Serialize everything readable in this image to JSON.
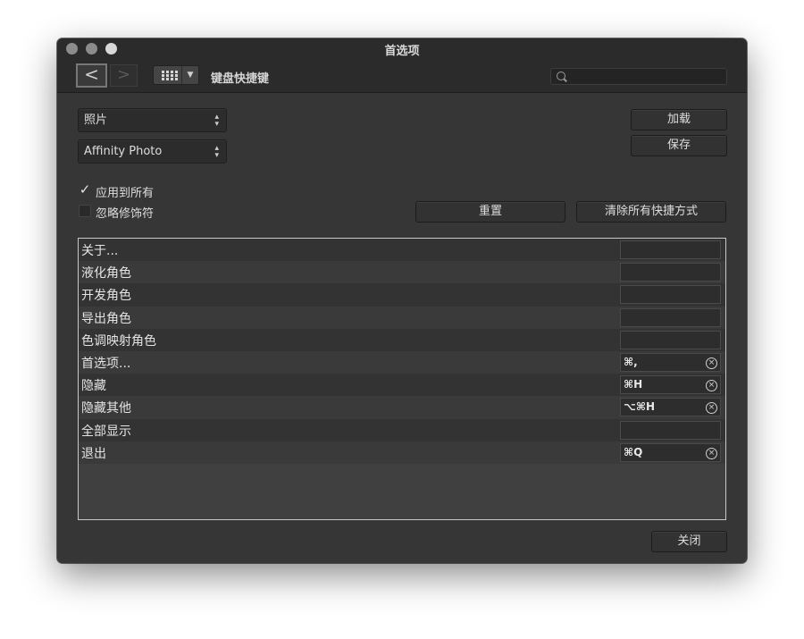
{
  "window": {
    "title": "首选项"
  },
  "toolbar": {
    "back_glyph": "<",
    "forward_glyph": ">",
    "view_caret": "▼",
    "section_label": "键盘快捷键",
    "search_placeholder": ""
  },
  "controls": {
    "category_select": "照片",
    "app_select": "Affinity Photo",
    "select_arrows": "⌃⌄",
    "load_button": "加载",
    "save_button": "保存",
    "apply_all": {
      "label": "应用到所有",
      "checked": true,
      "mark": "✓"
    },
    "ignore_modifiers": {
      "label": "忽略修饰符",
      "checked": false
    },
    "reset_button": "重置",
    "clear_all_button": "清除所有快捷方式"
  },
  "shortcuts": [
    {
      "name": "关于...",
      "keys": ""
    },
    {
      "name": "液化角色",
      "keys": ""
    },
    {
      "name": "开发角色",
      "keys": ""
    },
    {
      "name": "导出角色",
      "keys": ""
    },
    {
      "name": "色调映射角色",
      "keys": ""
    },
    {
      "name": "首选项...",
      "keys": "⌘,"
    },
    {
      "name": "隐藏",
      "keys": "⌘H"
    },
    {
      "name": "隐藏其他",
      "keys": "⌥⌘H"
    },
    {
      "name": "全部显示",
      "keys": ""
    },
    {
      "name": "退出",
      "keys": "⌘Q"
    }
  ],
  "clear_glyph": "×",
  "footer": {
    "close_button": "关闭"
  },
  "colors": {
    "window_bg": "#363636",
    "titlebar_bg": "#2b2b2b",
    "list_border": "#c8c8c8"
  }
}
